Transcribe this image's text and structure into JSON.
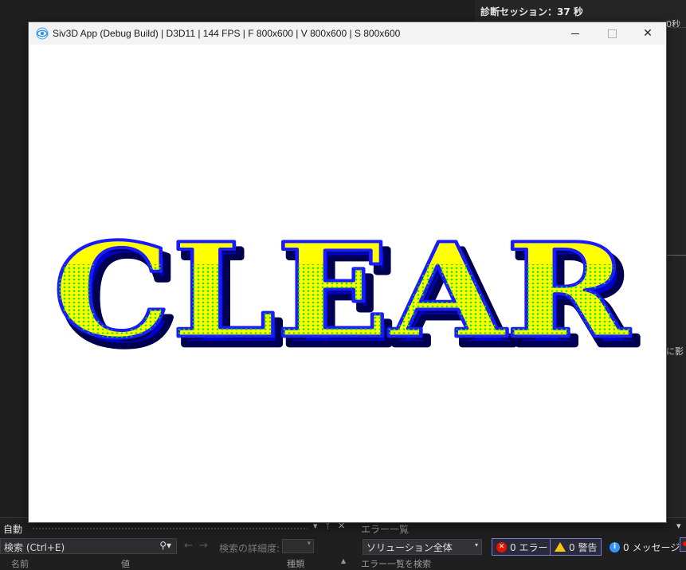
{
  "diagnostics": {
    "title": "診断セッション：37 秒",
    "partial_label": "0秒",
    "fragment_text": "に影"
  },
  "app_window": {
    "title": "Siv3D App (Debug Build) | D3D11 | 144 FPS | F 800x600 | V 800x600 | S 800x600",
    "icon": "siv3d-eye-icon",
    "buttons": {
      "minimize": "minimize-icon",
      "maximize": "maximize-icon",
      "close": "close-icon"
    },
    "canvas_text": "CLEAR",
    "colors": {
      "fill": "#ffff00",
      "outline": "#0000ff",
      "dots": "#00ff00",
      "background": "#ffffff"
    }
  },
  "autos_panel": {
    "title": "自動",
    "controls": [
      "▾",
      "ᛘ",
      "✕"
    ],
    "search_value": "検索 (Ctrl+E)",
    "search_icon": "search-icon",
    "nav_back": "←",
    "nav_forward": "→",
    "depth_label": "検索の詳細度:",
    "columns": [
      "名前",
      "値",
      "種類"
    ]
  },
  "error_list": {
    "title": "エラー一覧",
    "scope": "ソリューション全体",
    "errors_label": "0 エラー",
    "warnings_label": "0 警告",
    "messages_label": "0 メッセージ",
    "columns_partial": "エラー一覧を検索"
  }
}
